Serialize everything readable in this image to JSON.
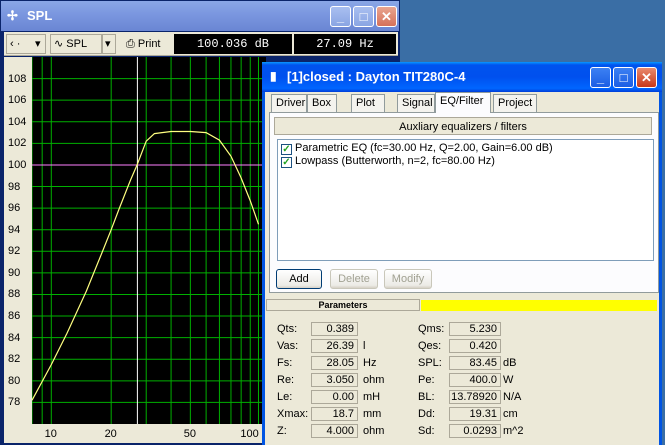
{
  "spl_window": {
    "title": "SPL",
    "toolbar": {
      "nav_label": "‹ ·",
      "spl_button": "SPL",
      "print_button": "Print",
      "readout_db": "100.036 dB",
      "readout_hz": "27.09 Hz"
    }
  },
  "chart_data": {
    "type": "line",
    "x_scale": "log",
    "xlim": [
      8,
      120
    ],
    "ylim": [
      76,
      110
    ],
    "y_ticks": [
      78,
      80,
      82,
      84,
      86,
      88,
      90,
      92,
      94,
      96,
      98,
      100,
      102,
      104,
      106,
      108
    ],
    "y_tick_labels": [
      "78",
      "80",
      "82",
      "84",
      "86",
      "88",
      "90",
      "92",
      "94",
      "96",
      "98",
      "100",
      "102",
      "104",
      "106",
      "108"
    ],
    "x_ticks": [
      10,
      20,
      50,
      100
    ],
    "x_tick_labels": [
      "10",
      "20",
      "50",
      "100"
    ],
    "grid": true,
    "grid_color": "#00b000",
    "curve_color": "#ffff80",
    "reference_line": {
      "y": 100,
      "color": "#ff80ff"
    },
    "cursor_line": {
      "x": 27.09,
      "color": "#ffffff"
    },
    "series": [
      {
        "x": [
          8,
          10,
          12,
          15,
          18,
          20,
          22,
          25,
          27,
          30,
          33,
          36,
          40,
          50,
          60,
          70,
          80,
          90,
          100,
          110
        ],
        "y": [
          78.2,
          81.5,
          84.4,
          88.3,
          91.9,
          94.0,
          96.0,
          98.6,
          100.0,
          102.2,
          102.9,
          103.0,
          103.1,
          103.1,
          103.0,
          102.3,
          100.8,
          98.8,
          96.7,
          94.5
        ]
      }
    ]
  },
  "dayton_window": {
    "title": "[1]closed : Dayton TIT280C-4",
    "tabs": [
      "Driver",
      "Box",
      "Plot",
      "Signal",
      "EQ/Filter",
      "Project"
    ],
    "active_tab": "EQ/Filter",
    "aux_button": "Auxliary equalizers / filters",
    "filters": [
      {
        "checked": true,
        "label": "Parametric EQ (fc=30.00 Hz, Q=2.00, Gain=6.00 dB)"
      },
      {
        "checked": true,
        "label": "Lowpass (Butterworth, n=2, fc=80.00 Hz)"
      }
    ],
    "buttons": {
      "add": "Add",
      "delete": "Delete",
      "modify": "Modify"
    },
    "params_header": "Parameters",
    "params_left": [
      {
        "label": "Qts:",
        "value": "0.389",
        "unit": ""
      },
      {
        "label": "Vas:",
        "value": "26.39",
        "unit": "l"
      },
      {
        "label": "Fs:",
        "value": "28.05",
        "unit": "Hz"
      },
      {
        "label": "Re:",
        "value": "3.050",
        "unit": "ohm"
      },
      {
        "label": "Le:",
        "value": "0.00",
        "unit": "mH"
      },
      {
        "label": "Xmax:",
        "value": "18.7",
        "unit": "mm"
      },
      {
        "label": "Z:",
        "value": "4.000",
        "unit": "ohm"
      }
    ],
    "params_right": [
      {
        "label": "Qms:",
        "value": "5.230",
        "unit": ""
      },
      {
        "label": "Qes:",
        "value": "0.420",
        "unit": ""
      },
      {
        "label": "SPL:",
        "value": "83.45",
        "unit": "dB"
      },
      {
        "label": "Pe:",
        "value": "400.0",
        "unit": "W"
      },
      {
        "label": "BL:",
        "value": "13.78920",
        "unit": "N/A"
      },
      {
        "label": "Dd:",
        "value": "19.31",
        "unit": "cm"
      },
      {
        "label": "Sd:",
        "value": "0.0293",
        "unit": "m^2"
      }
    ]
  }
}
